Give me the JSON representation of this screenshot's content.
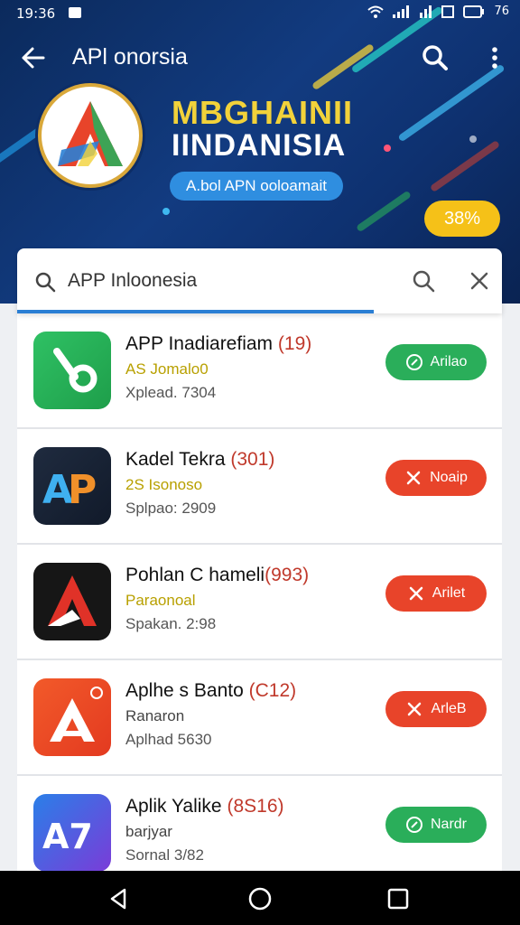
{
  "status_bar": {
    "time": "19:36",
    "battery": "76"
  },
  "header": {
    "title": "APl onorsia"
  },
  "banner": {
    "headline1": "MBGHAINII",
    "headline2": "IINDANISIA",
    "pill_label": "A.bol APN ooloamait",
    "discount": "38%"
  },
  "search": {
    "value": "APP Inloonesia"
  },
  "apps": [
    {
      "name": "APP Inadiarefiam",
      "rank": "(19)",
      "sub": "AS Jomalo0",
      "sub_color": "#b8a000",
      "meta": "Xplead. 7304",
      "action": "Arilao",
      "action_style": "green"
    },
    {
      "name": "Kadel Tekra",
      "rank": "(301)",
      "sub": "2S Isonoso",
      "sub_color": "#b8a000",
      "meta": "Splpao: 2909",
      "action": "Noaip",
      "action_style": "red"
    },
    {
      "name": "Pohlan C hameli",
      "rank": "(993)",
      "sub": "Paraonoal",
      "sub_color": "#b8a000",
      "meta": "Spakan. 2:98",
      "action": "Arilet",
      "action_style": "red"
    },
    {
      "name": "Aplhe s Banto",
      "rank": "(C12)",
      "sub": "Ranaron",
      "sub_color": "#444444",
      "meta": "Aplhad 5630",
      "action": "ArleB",
      "action_style": "red"
    },
    {
      "name": "Aplik Yalike",
      "rank": "(8S16)",
      "sub": "barjyar",
      "sub_color": "#444444",
      "meta": "Sornal 3/82",
      "action": "Nardr",
      "action_style": "green"
    }
  ],
  "colors": {
    "accent": "#2b7fd4",
    "install_green": "#2aae5a",
    "open_red": "#e8442a",
    "banner_dark": "#0b2a5c",
    "gold": "#f2d23a"
  }
}
